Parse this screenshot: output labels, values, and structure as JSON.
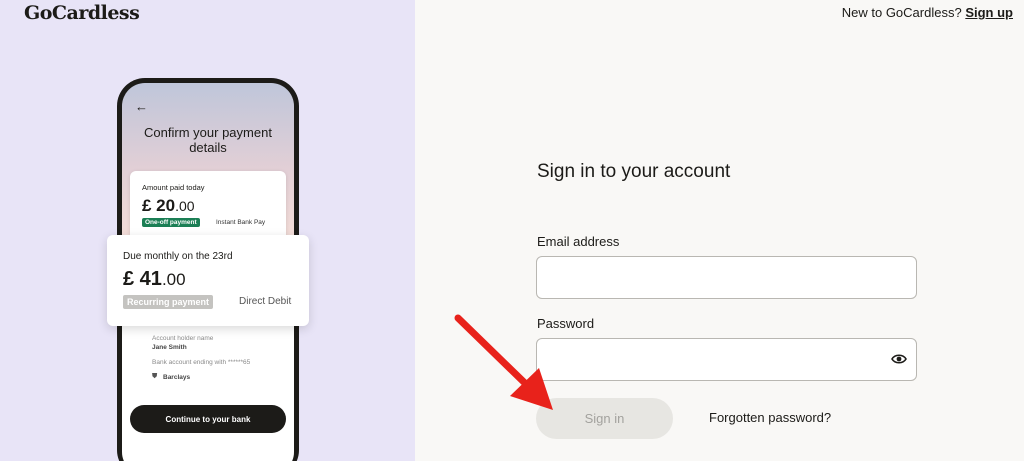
{
  "brand": {
    "logo": "GoCardless"
  },
  "header": {
    "prompt": "New to GoCardless?",
    "signup_label": "Sign up"
  },
  "phone": {
    "back_icon": "back-arrow-icon",
    "title": "Confirm your payment details",
    "card_small": {
      "label": "Amount paid today",
      "amount_main": "£ 20",
      "amount_dec": ".00",
      "badge": "One-off payment",
      "method": "Instant Bank Pay"
    },
    "card_big": {
      "label": "Due monthly on the 23rd",
      "amount_main": "£ 41",
      "amount_dec": ".00",
      "badge": "Recurring payment",
      "method": "Direct Debit"
    },
    "details": {
      "holder_label": "Account holder name",
      "holder_value": "Jane Smith",
      "account_label": "Bank account ending with ******65",
      "bank_icon": "bank-icon",
      "bank_name": "Barclays"
    },
    "continue_label": "Continue to your bank"
  },
  "form": {
    "title": "Sign in to your account",
    "email_label": "Email address",
    "email_value": "",
    "password_label": "Password",
    "password_value": "",
    "show_password_icon": "eye-icon",
    "signin_label": "Sign in",
    "forgot_label": "Forgotten password?"
  },
  "colors": {
    "left_panel": "#e8e4f7",
    "page_bg": "#f9f8f6",
    "badge_green": "#1b7f55",
    "annotation_arrow": "#e8221b"
  }
}
